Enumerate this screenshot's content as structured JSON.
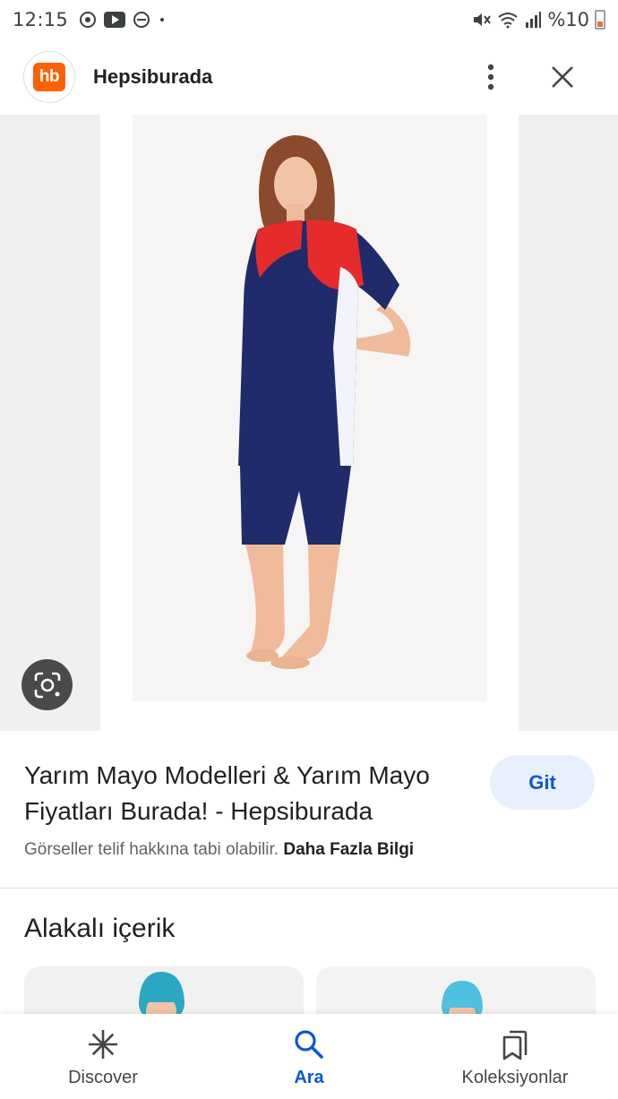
{
  "status": {
    "time": "12:15",
    "battery": "%10",
    "left_icons": [
      "sync-icon",
      "youtube-icon",
      "dnd-icon",
      "dot-icon"
    ],
    "right_icons": [
      "mute-icon",
      "wifi-icon",
      "signal-icon",
      "battery-icon"
    ]
  },
  "header": {
    "logo_text": "hb",
    "site_name": "Hepsiburada"
  },
  "result": {
    "title": "Yarım Mayo Modelleri & Yarım Mayo Fiyatları Burada! - Hepsiburada",
    "visit_button": "Git",
    "copyright_text": "Görseller telif hakkına tabi olabilir.",
    "learn_more": "Daha Fazla Bilgi"
  },
  "related": {
    "title": "Alakalı içerik"
  },
  "bottom_nav": {
    "items": [
      {
        "label": "Discover",
        "icon": "asterisk-icon",
        "active": false
      },
      {
        "label": "Ara",
        "icon": "search-icon",
        "active": true
      },
      {
        "label": "Koleksiyonlar",
        "icon": "collections-icon",
        "active": false
      }
    ]
  },
  "colors": {
    "brand": "#ff6000",
    "accent": "#0b57d0",
    "button_bg": "#e8f0fe"
  }
}
